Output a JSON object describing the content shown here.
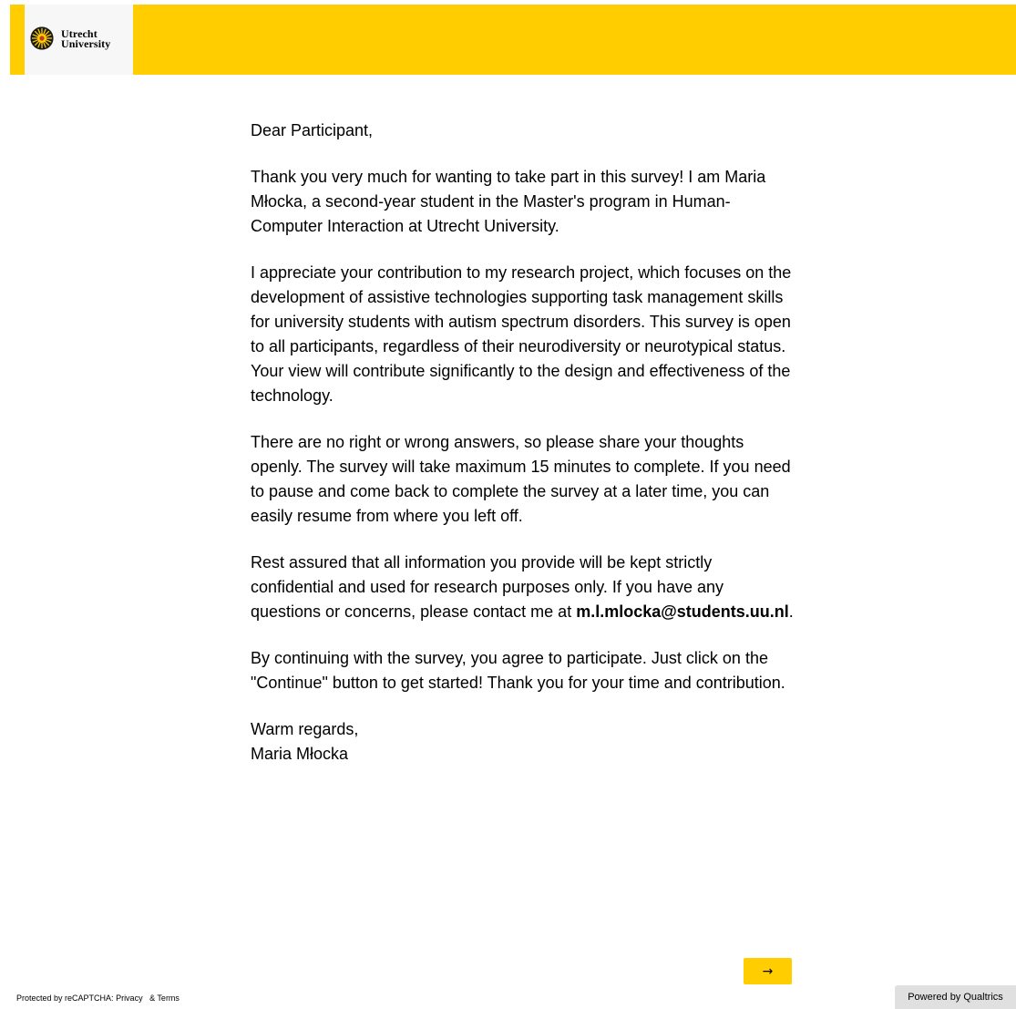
{
  "header": {
    "logo_line1": "Utrecht",
    "logo_line2": "University",
    "accent_color": "#ffcd00"
  },
  "letter": {
    "greeting": "Dear Participant,",
    "p1": "Thank you very much for wanting to take part in this survey! I am Maria Młocka, a second-year student in the Master's program in Human-Computer Interaction at Utrecht University.",
    "p2": "I appreciate your contribution to my research project, which focuses on the development of assistive technologies supporting task management skills for university students with autism spectrum disorders. This survey is open to all participants, regardless of their neurodiversity or neurotypical status. Your view will contribute significantly to the design and effectiveness of the technology.",
    "p3": "There are no right or wrong answers, so please share your thoughts openly. The survey will take maximum 15 minutes to complete. If you need to pause and come back to complete the survey at a later time, you can easily resume from where you left off.",
    "p4_text": "Rest assured that all information you provide will be kept strictly confidential and used for research purposes only. If you have any questions or concerns, please contact me at ",
    "p4_email": "m.l.mlocka@students.uu.nl",
    "p4_end": ".",
    "p5": "By continuing with the survey, you agree to participate. Just click on the \"Continue\" button to get started! Thank you for your time and contribution.",
    "closing": "Warm regards,",
    "signature": "Maria Młocka"
  },
  "navigation": {
    "next_label": "→",
    "next_icon": "arrow-right-icon"
  },
  "footer": {
    "recaptcha_label": "Protected by reCAPTCHA:",
    "privacy_link": "Privacy",
    "terms_link": "& Terms",
    "powered_by": "Powered by Qualtrics"
  }
}
